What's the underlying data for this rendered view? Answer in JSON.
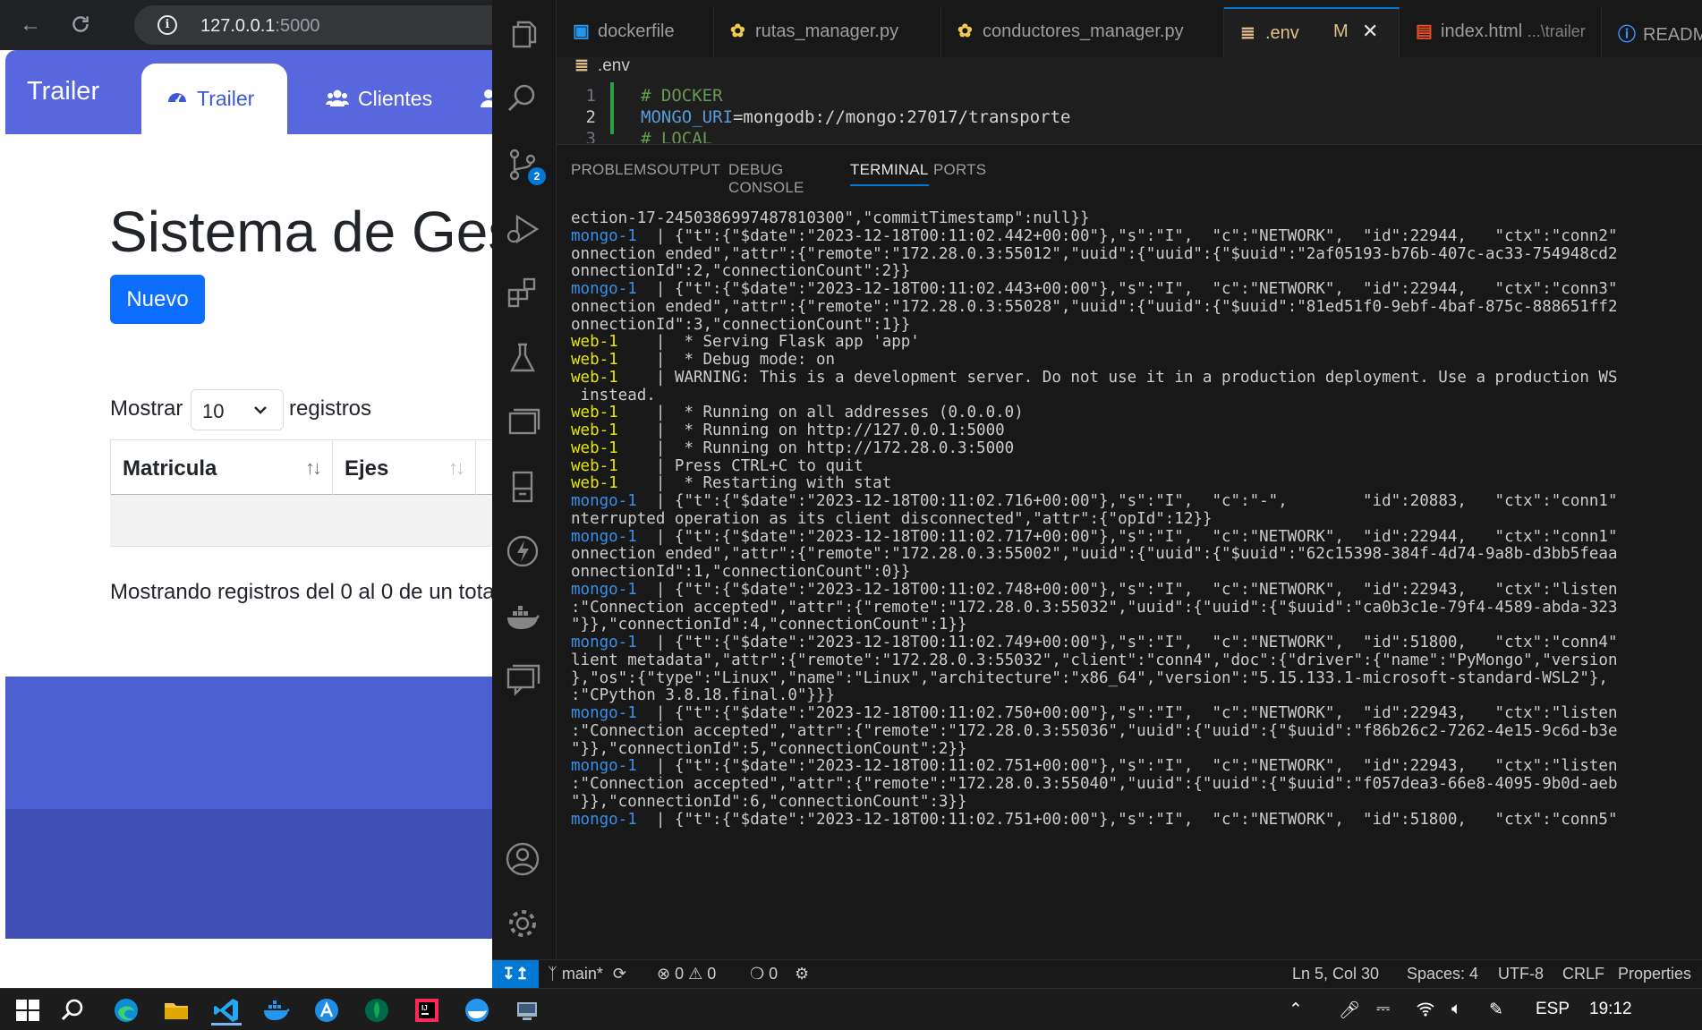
{
  "browser": {
    "url_host": "127.0.0.1",
    "url_port": ":5000",
    "site": {
      "brand": "Trailer",
      "tabs": [
        "Trailer",
        "Clientes"
      ],
      "title": "Sistema de Gest",
      "new_button": "Nuevo",
      "show_label": "Mostrar",
      "page_length": "10",
      "records_label": "registros",
      "columns": [
        "Matricula",
        "Ejes"
      ],
      "info": "Mostrando registros del 0 al 0 de un tota"
    }
  },
  "vscode": {
    "tabs": [
      {
        "label": "dockerfile",
        "icon": "docker-icon"
      },
      {
        "label": "rutas_manager.py",
        "icon": "python-icon"
      },
      {
        "label": "conductores_manager.py",
        "icon": "python-icon"
      },
      {
        "label": ".env",
        "icon": "env-icon",
        "modified": "M",
        "active": true
      },
      {
        "label": "index.html",
        "sub": "...\\trailer",
        "icon": "html-icon"
      },
      {
        "label": "READM",
        "icon": "info-icon"
      }
    ],
    "breadcrumb": ".env",
    "editor_lines": [
      {
        "n": "1",
        "text": "# DOCKER"
      },
      {
        "n": "2",
        "key": "MONGO_URI",
        "eq": "=",
        "value": "mongodb://mongo:27017/transporte"
      },
      {
        "n": "3",
        "text": "# LOCAL"
      }
    ],
    "scm_badge": "2",
    "panel_tabs": [
      "PROBLEMS",
      "OUTPUT",
      "DEBUG CONSOLE",
      "TERMINAL",
      "PORTS"
    ],
    "terminal_lines": [
      {
        "p": "",
        "t": "ection-17-2450386997487810300\",\"commitTimestamp\":null}}"
      },
      {
        "p": "mongo-1",
        "t": "  | {\"t\":{\"$date\":\"2023-12-18T00:11:02.442+00:00\"},\"s\":\"I\",  \"c\":\"NETWORK\",  \"id\":22944,   \"ctx\":\"conn2\""
      },
      {
        "p": "",
        "t": "onnection ended\",\"attr\":{\"remote\":\"172.28.0.3:55012\",\"uuid\":{\"uuid\":{\"$uuid\":\"2af05193-b76b-407c-ac33-754948cd2"
      },
      {
        "p": "",
        "t": "onnectionId\":2,\"connectionCount\":2}}"
      },
      {
        "p": "mongo-1",
        "t": "  | {\"t\":{\"$date\":\"2023-12-18T00:11:02.443+00:00\"},\"s\":\"I\",  \"c\":\"NETWORK\",  \"id\":22944,   \"ctx\":\"conn3\""
      },
      {
        "p": "",
        "t": "onnection ended\",\"attr\":{\"remote\":\"172.28.0.3:55028\",\"uuid\":{\"uuid\":{\"$uuid\":\"81ed51f0-9ebf-4baf-875c-888651ff2"
      },
      {
        "p": "",
        "t": "onnectionId\":3,\"connectionCount\":1}}"
      },
      {
        "p": "web-1",
        "t": "    |  * Serving Flask app 'app'"
      },
      {
        "p": "web-1",
        "t": "    |  * Debug mode: on"
      },
      {
        "p": "web-1",
        "t": "    | WARNING: This is a development server. Do not use it in a production deployment. Use a production WS"
      },
      {
        "p": "",
        "t": " instead."
      },
      {
        "p": "web-1",
        "t": "    |  * Running on all addresses (0.0.0.0)"
      },
      {
        "p": "web-1",
        "t": "    |  * Running on http://127.0.0.1:5000"
      },
      {
        "p": "web-1",
        "t": "    |  * Running on http://172.28.0.3:5000"
      },
      {
        "p": "web-1",
        "t": "    | Press CTRL+C to quit"
      },
      {
        "p": "web-1",
        "t": "    |  * Restarting with stat"
      },
      {
        "p": "mongo-1",
        "t": "  | {\"t\":{\"$date\":\"2023-12-18T00:11:02.716+00:00\"},\"s\":\"I\",  \"c\":\"-\",        \"id\":20883,   \"ctx\":\"conn1\""
      },
      {
        "p": "",
        "t": "nterrupted operation as its client disconnected\",\"attr\":{\"opId\":12}}"
      },
      {
        "p": "mongo-1",
        "t": "  | {\"t\":{\"$date\":\"2023-12-18T00:11:02.717+00:00\"},\"s\":\"I\",  \"c\":\"NETWORK\",  \"id\":22944,   \"ctx\":\"conn1\""
      },
      {
        "p": "",
        "t": "onnection ended\",\"attr\":{\"remote\":\"172.28.0.3:55002\",\"uuid\":{\"uuid\":{\"$uuid\":\"62c15398-384f-4d74-9a8b-d3bb5feaa"
      },
      {
        "p": "",
        "t": "onnectionId\":1,\"connectionCount\":0}}"
      },
      {
        "p": "mongo-1",
        "t": "  | {\"t\":{\"$date\":\"2023-12-18T00:11:02.748+00:00\"},\"s\":\"I\",  \"c\":\"NETWORK\",  \"id\":22943,   \"ctx\":\"listen"
      },
      {
        "p": "",
        "t": ":\"Connection accepted\",\"attr\":{\"remote\":\"172.28.0.3:55032\",\"uuid\":{\"uuid\":{\"$uuid\":\"ca0b3c1e-79f4-4589-abda-323"
      },
      {
        "p": "",
        "t": "\"}},\"connectionId\":4,\"connectionCount\":1}}"
      },
      {
        "p": "mongo-1",
        "t": "  | {\"t\":{\"$date\":\"2023-12-18T00:11:02.749+00:00\"},\"s\":\"I\",  \"c\":\"NETWORK\",  \"id\":51800,   \"ctx\":\"conn4\""
      },
      {
        "p": "",
        "t": "lient metadata\",\"attr\":{\"remote\":\"172.28.0.3:55032\",\"client\":\"conn4\",\"doc\":{\"driver\":{\"name\":\"PyMongo\",\"version"
      },
      {
        "p": "",
        "t": "},\"os\":{\"type\":\"Linux\",\"name\":\"Linux\",\"architecture\":\"x86_64\",\"version\":\"5.15.133.1-microsoft-standard-WSL2\"},"
      },
      {
        "p": "",
        "t": ":\"CPython 3.8.18.final.0\"}}}"
      },
      {
        "p": "mongo-1",
        "t": "  | {\"t\":{\"$date\":\"2023-12-18T00:11:02.750+00:00\"},\"s\":\"I\",  \"c\":\"NETWORK\",  \"id\":22943,   \"ctx\":\"listen"
      },
      {
        "p": "",
        "t": ":\"Connection accepted\",\"attr\":{\"remote\":\"172.28.0.3:55036\",\"uuid\":{\"uuid\":{\"$uuid\":\"f86b26c2-7262-4e15-9c6d-b3e"
      },
      {
        "p": "",
        "t": "\"}},\"connectionId\":5,\"connectionCount\":2}}"
      },
      {
        "p": "mongo-1",
        "t": "  | {\"t\":{\"$date\":\"2023-12-18T00:11:02.751+00:00\"},\"s\":\"I\",  \"c\":\"NETWORK\",  \"id\":22943,   \"ctx\":\"listen"
      },
      {
        "p": "",
        "t": ":\"Connection accepted\",\"attr\":{\"remote\":\"172.28.0.3:55040\",\"uuid\":{\"uuid\":{\"$uuid\":\"f057dea3-66e8-4095-9b0d-aeb"
      },
      {
        "p": "",
        "t": "\"}},\"connectionId\":6,\"connectionCount\":3}}"
      },
      {
        "p": "mongo-1",
        "t": "  | {\"t\":{\"$date\":\"2023-12-18T00:11:02.751+00:00\"},\"s\":\"I\",  \"c\":\"NETWORK\",  \"id\":51800,   \"ctx\":\"conn5\""
      }
    ],
    "status": {
      "branch": "main*",
      "errors": "0",
      "warnings": "0",
      "ports": "0",
      "position": "Ln 5, Col 30",
      "spaces": "Spaces: 4",
      "encoding": "UTF-8",
      "eol": "CRLF",
      "language": "Properties"
    }
  },
  "taskbar": {
    "language": "ESP",
    "time": "19:12",
    "apps": [
      "windows-start-icon",
      "search-icon",
      "edge-icon",
      "file-explorer-icon",
      "vscode-icon",
      "docker-desktop-icon",
      "app-icon",
      "mongodb-compass-icon",
      "intellij-icon",
      "docker-icon",
      "app-window-icon"
    ]
  },
  "colors": {
    "site_nav": "#5867dd",
    "primary_button": "#0d6efd",
    "vscode_accent": "#0078d4",
    "terminal_mongo": "#3b8eea",
    "terminal_web": "#e5e510"
  }
}
